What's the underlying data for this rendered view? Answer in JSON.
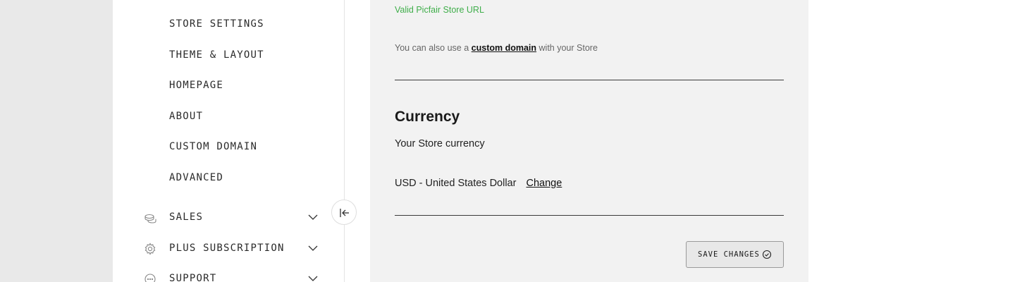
{
  "sidebar": {
    "store_items": [
      {
        "label": "STORE SETTINGS"
      },
      {
        "label": "THEME & LAYOUT"
      },
      {
        "label": "HOMEPAGE"
      },
      {
        "label": "ABOUT"
      },
      {
        "label": "CUSTOM DOMAIN"
      },
      {
        "label": "ADVANCED"
      }
    ],
    "sections": [
      {
        "label": "SALES",
        "icon": "coins-icon"
      },
      {
        "label": "PLUS SUBSCRIPTION",
        "icon": "gear-icon"
      },
      {
        "label": "SUPPORT",
        "icon": "chat-icon"
      }
    ],
    "collapse_icon": "collapse-left-icon"
  },
  "main": {
    "valid_message": "Valid Picfair Store URL",
    "domain_note": {
      "prefix": "You can also use a",
      "link": "custom domain",
      "suffix": "with your Store"
    },
    "currency": {
      "heading": "Currency",
      "subheading": "Your Store currency",
      "value": "USD - United States Dollar",
      "change_label": "Change"
    },
    "save_label": "SAVE CHANGES",
    "colors": {
      "valid_green": "#3fae4a",
      "panel_bg": "#f2f2f2",
      "page_bg": "#e9e9e9"
    }
  }
}
